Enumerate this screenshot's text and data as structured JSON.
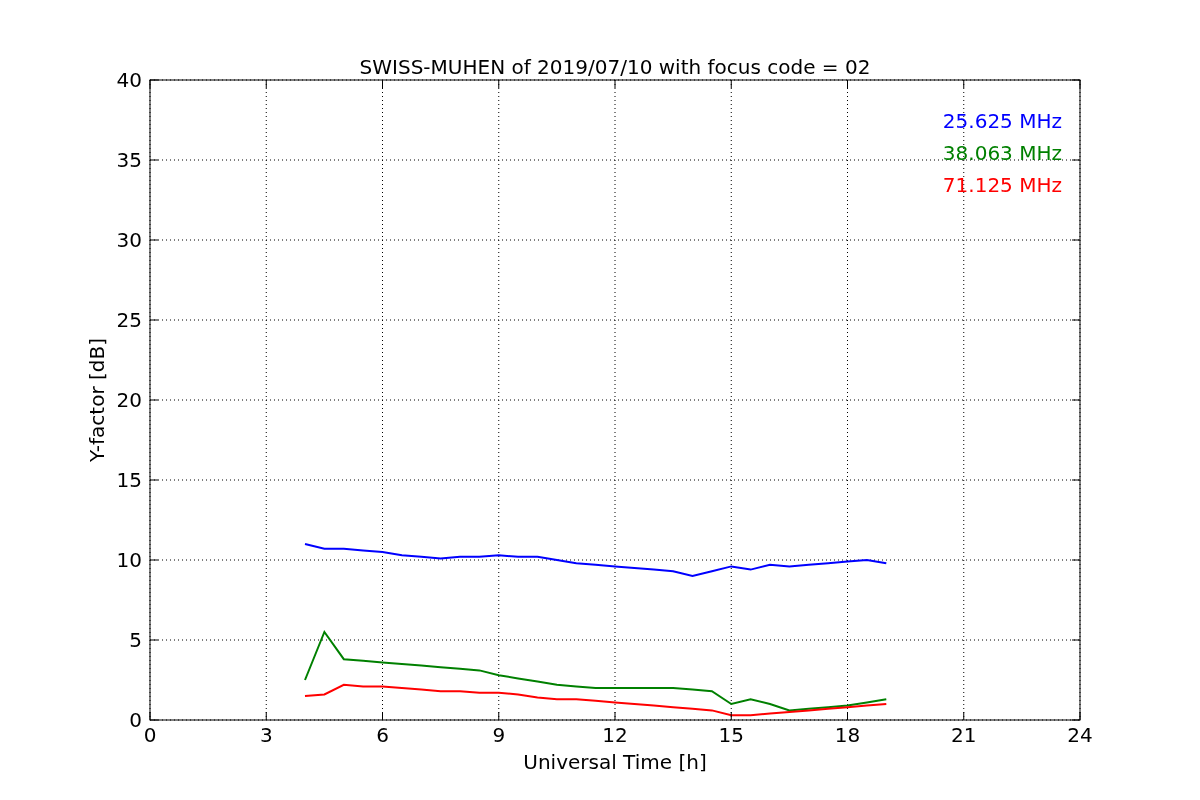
{
  "chart_data": {
    "type": "line",
    "title": "SWISS-MUHEN of 2019/07/10 with focus code = 02",
    "xlabel": "Universal Time [h]",
    "ylabel": "Y-factor [dB]",
    "x": [
      4,
      4.5,
      5,
      5.5,
      6,
      6.5,
      7,
      7.5,
      8,
      8.5,
      9,
      9.5,
      10,
      10.5,
      11,
      11.5,
      12,
      12.5,
      13,
      13.5,
      14,
      14.5,
      15,
      15.5,
      16,
      16.5,
      17,
      17.5,
      18,
      18.5,
      19
    ],
    "series": [
      {
        "name": "25.625 MHz",
        "color": "#0000ff",
        "values": [
          11,
          10.7,
          10.7,
          10.6,
          10.5,
          10.3,
          10.2,
          10.1,
          10.2,
          10.2,
          10.3,
          10.2,
          10.2,
          10,
          9.8,
          9.7,
          9.6,
          9.5,
          9.4,
          9.3,
          9,
          9.3,
          9.6,
          9.4,
          9.7,
          9.6,
          9.7,
          9.8,
          9.9,
          10,
          9.8
        ]
      },
      {
        "name": "38.063 MHz",
        "color": "#008000",
        "values": [
          2.5,
          5.5,
          3.8,
          3.7,
          3.6,
          3.5,
          3.4,
          3.3,
          3.2,
          3.1,
          2.8,
          2.6,
          2.4,
          2.2,
          2.1,
          2,
          2,
          2,
          2,
          2,
          1.9,
          1.8,
          1,
          1.3,
          1,
          0.6,
          0.7,
          0.8,
          0.9,
          1.1,
          1.3
        ]
      },
      {
        "name": "71.125 MHz",
        "color": "#ff0000",
        "values": [
          1.5,
          1.6,
          2.2,
          2.1,
          2.1,
          2,
          1.9,
          1.8,
          1.8,
          1.7,
          1.7,
          1.6,
          1.4,
          1.3,
          1.3,
          1.2,
          1.1,
          1,
          0.9,
          0.8,
          0.7,
          0.6,
          0.3,
          0.3,
          0.4,
          0.5,
          0.6,
          0.7,
          0.8,
          0.9,
          1
        ]
      }
    ],
    "xlim": [
      0,
      24
    ],
    "ylim": [
      0,
      40
    ],
    "xticks": [
      0,
      3,
      6,
      9,
      12,
      15,
      18,
      21,
      24
    ],
    "yticks": [
      0,
      5,
      10,
      15,
      20,
      25,
      30,
      35,
      40
    ],
    "grid": true
  }
}
